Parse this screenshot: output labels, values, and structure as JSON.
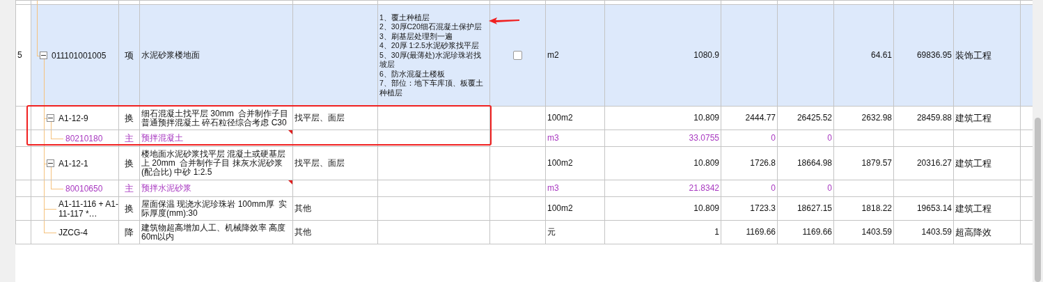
{
  "rows": [
    {
      "index": "5",
      "code": "011101001005",
      "material": false,
      "expanded": true,
      "selected": true,
      "type": "项",
      "name": "水泥砂浆楼地面",
      "description": [
        "1、覆土种植层",
        "2、30厚C20细石混凝土保护层",
        "3、刷基层处理剂一遍",
        "4、20厚 1:2.5水泥砂浆找平层",
        "5、30厚(最薄处)水泥珍珠岩找坡层",
        "6、防水混凝土楼板",
        "7、部位：地下车库顶、板覆土种植层"
      ],
      "checkbox": {
        "checked": false
      },
      "unit": "m2",
      "quantity": "1080.9",
      "column_10": "",
      "column_11": "",
      "column_12": "64.61",
      "column_13": "69836.95",
      "column_14": "装饰工程",
      "children": [
        {
          "code": "A1-12-9",
          "material": false,
          "expanded": true,
          "selected": false,
          "type": "换",
          "name": "细石混凝土找平层 30mm  合并制作子目普通预拌混凝土 碎石粒径综合考虑 C30",
          "feature": "找平层、面层",
          "unit": "100m2",
          "quantity": "10.809",
          "column_10": "2444.77",
          "column_11": "26425.52",
          "column_12": "2632.98",
          "column_13": "28459.88",
          "column_14": "建筑工程",
          "children": [
            {
              "code": "80210180",
              "material": true,
              "selected": false,
              "note": true,
              "type": "主",
              "name": "预拌混凝土",
              "unit": "m3",
              "quantity": "33.0755",
              "column_10": "0",
              "column_11": "0"
            }
          ]
        },
        {
          "code": "A1-12-1",
          "material": false,
          "expanded": true,
          "selected": false,
          "type": "换",
          "name": "楼地面水泥砂浆找平层 混凝土或硬基层上 20mm  合并制作子目 抹灰水泥砂浆(配合比) 中砂 1:2.5",
          "feature": "找平层、面层",
          "unit": "100m2",
          "quantity": "10.809",
          "column_10": "1726.8",
          "column_11": "18664.98",
          "column_12": "1879.57",
          "column_13": "20316.27",
          "column_14": "建筑工程",
          "children": [
            {
              "code": "80010650",
              "material": true,
              "selected": false,
              "note": true,
              "type": "主",
              "name": "预拌水泥砂浆",
              "unit": "m3",
              "quantity": "21.8342",
              "column_10": "0",
              "column_11": "0"
            }
          ]
        },
        {
          "code": "A1-11-116 + A1-11-117 *…",
          "material": false,
          "selected": false,
          "type": "换",
          "name": "屋面保温 现浇水泥珍珠岩 100mm厚  实际厚度(mm):30",
          "feature": "其他",
          "unit": "100m2",
          "quantity": "10.809",
          "column_10": "1723.3",
          "column_11": "18627.15",
          "column_12": "1818.22",
          "column_13": "19653.14",
          "column_14": "建筑工程"
        },
        {
          "code": "JZCG-4",
          "material": false,
          "selected": false,
          "type": "降",
          "name": "建筑物超高增加人工、机械降效率 高度60m以内",
          "feature": "其他",
          "unit": "元",
          "quantity": "1",
          "column_10": "1169.66",
          "column_11": "1169.66",
          "column_12": "1403.59",
          "column_13": "1403.59",
          "column_14": "超高降效"
        }
      ]
    }
  ]
}
